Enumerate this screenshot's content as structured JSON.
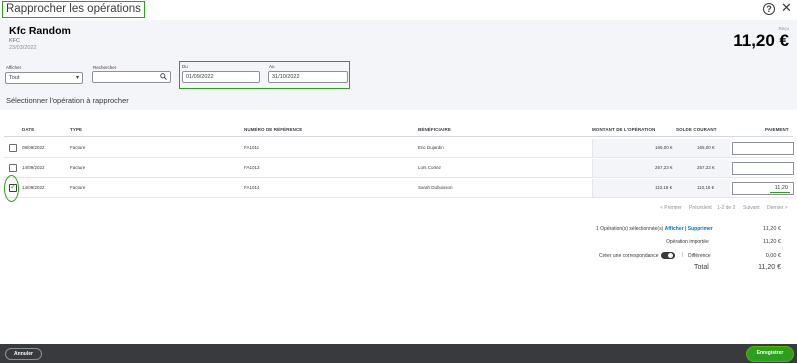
{
  "window": {
    "title": "Rapprocher les opérations"
  },
  "account": {
    "name": "Kfc Random",
    "code": "KFC",
    "date": "23/03/2022",
    "amount_label": "Reçu",
    "amount": "11,20 €"
  },
  "filters": {
    "show_label": "Afficher",
    "show_value": "Tout",
    "search_label": "Rechercher",
    "search_value": "",
    "from_label": "Du",
    "from_value": "01/09/2022",
    "to_label": "Au",
    "to_value": "31/10/2022"
  },
  "section_title": "Sélectionner l'opération à rapprocher",
  "table": {
    "columns": [
      "DATE",
      "TYPE",
      "NUMÉRO DE RÉFÉRENCE",
      "BÉNÉFICIAIRE",
      "MONTANT DE L'OPÉRATION",
      "SOLDE COURANT",
      "PAIEMENT"
    ],
    "rows": [
      {
        "date": "08/09/2022",
        "type": "Facture",
        "ref": "FA1011",
        "payee": "Eric Dujardin",
        "amount": "165,00 €",
        "balance": "165,00 €",
        "payment": "",
        "checked": false
      },
      {
        "date": "14/09/2022",
        "type": "Facture",
        "ref": "FA1013",
        "payee": "Loïs Cortez",
        "amount": "257,23 €",
        "balance": "257,23 €",
        "payment": "",
        "checked": false
      },
      {
        "date": "14/09/2022",
        "type": "Facture",
        "ref": "FA1014",
        "payee": "Sarah Dubuisson",
        "amount": "110,18 €",
        "balance": "110,18 €",
        "payment": "11,20",
        "checked": true
      }
    ]
  },
  "pager": {
    "first": "< Premier",
    "prev": "Précédent",
    "range": "1-2 de 2",
    "next": "Suivant",
    "last": "Dernier >"
  },
  "summary": {
    "selected_label": "1 Opération(s) sélectionnée(s)",
    "show_link": "Afficher",
    "separator": "|",
    "delete_link": "Supprimer",
    "selected_value": "11,20 €",
    "imported_label": "Opération importée",
    "imported_value": "11,20 €",
    "match_label": "Créer une correspondance",
    "difference_label": "Différence",
    "difference_value": "0,00 €",
    "total_label": "Total",
    "total_value": "11,20 €"
  },
  "footer": {
    "cancel_label": "Annuler",
    "save_label": "Enregistrer"
  },
  "colors": {
    "accent_green": "#2ca01c",
    "link_blue": "#0077c5",
    "footer_dark": "#393a3d"
  }
}
